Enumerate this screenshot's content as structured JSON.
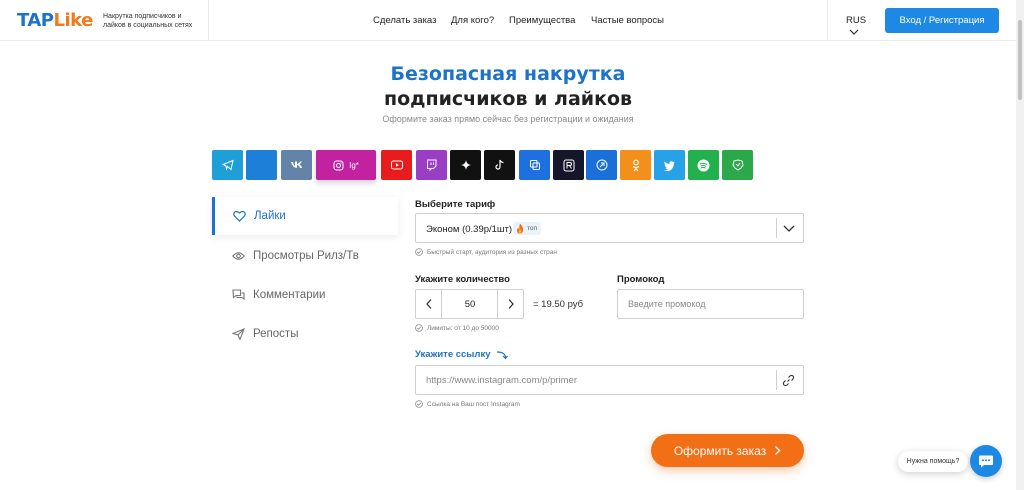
{
  "header": {
    "logo_part1": "TAP",
    "logo_part2": "Like",
    "tagline": "Накрутка подписчиков и лайков в социальных сетях",
    "nav": [
      "Сделать заказ",
      "Для кого?",
      "Преимущества",
      "Частые вопросы"
    ],
    "lang": "RUS",
    "login_label": "Вход / Регистрация"
  },
  "hero": {
    "title_line1": "Безопасная накрутка",
    "title_line2": "подписчиков и лайков",
    "subtitle": "Оформите заказ прямо сейчас без регистрации и ожидания"
  },
  "socials": [
    {
      "name": "telegram",
      "color": "#1e9fd8"
    },
    {
      "name": "facebook",
      "color": "#1e7fd8"
    },
    {
      "name": "vk",
      "color": "#6384a8"
    },
    {
      "name": "instagram",
      "color": "#c2229f",
      "active": true
    },
    {
      "name": "youtube",
      "color": "#e81c1c"
    },
    {
      "name": "twitch",
      "color": "#9a3fc4"
    },
    {
      "name": "threads",
      "color": "#111111"
    },
    {
      "name": "tiktok",
      "color": "#111111"
    },
    {
      "name": "likee",
      "color": "#1e6fe0"
    },
    {
      "name": "rutube",
      "color": "#16162a"
    },
    {
      "name": "yandex-zen",
      "color": "#1a6fd8"
    },
    {
      "name": "odnoklassniki",
      "color": "#f39019"
    },
    {
      "name": "twitter",
      "color": "#27a2e8"
    },
    {
      "name": "spotify",
      "color": "#22b14c"
    },
    {
      "name": "other",
      "color": "#2aa84a"
    }
  ],
  "instagram_tile_text": "Ig*",
  "menu": [
    {
      "label": "Лайки",
      "icon": "heart-icon",
      "active": true
    },
    {
      "label": "Просмотры Рилз/Тв",
      "icon": "eye-icon"
    },
    {
      "label": "Комментарии",
      "icon": "comments-icon"
    },
    {
      "label": "Репосты",
      "icon": "send-icon"
    }
  ],
  "form": {
    "tariff_label": "Выберите тариф",
    "tariff_value": "Эконом (0.39р/1шт)",
    "tariff_badge": "топ",
    "tariff_hint": "Быстрый старт, аудитория из разных стран",
    "quantity_label": "Укажите количество",
    "quantity_value": "50",
    "quantity_total": "= 19.50 руб",
    "quantity_hint": "Лимиты: от 10 до 50000",
    "promo_label": "Промокод",
    "promo_placeholder": "Введите промокод",
    "link_label": "Укажите ссылку",
    "link_placeholder": "https://www.instagram.com/p/primer",
    "link_hint": "Ссылка на Ваш пост Instagram",
    "submit_label": "Оформить заказ"
  },
  "help": {
    "bubble_text": "Нужна помощь?"
  },
  "colors": {
    "accent": "#1d72c9",
    "primary_button": "#1e88e5",
    "order_button": "#f26f16"
  }
}
